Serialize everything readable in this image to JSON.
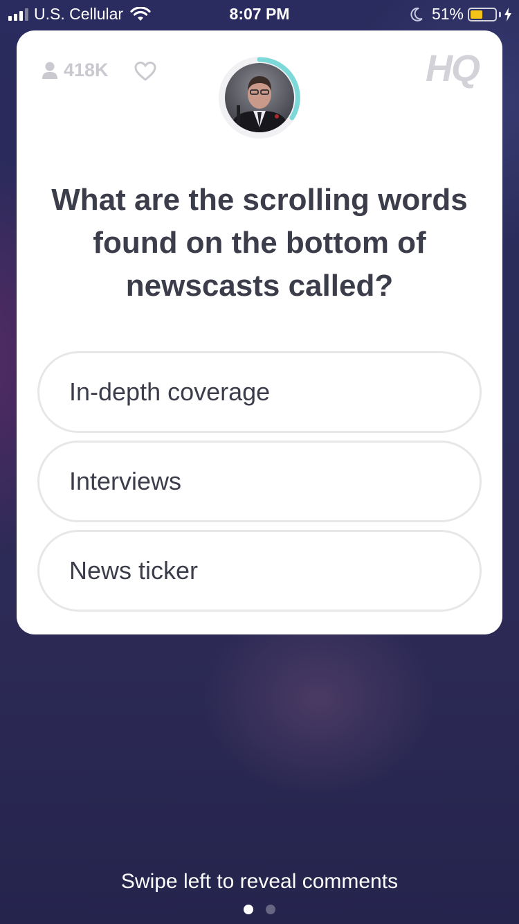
{
  "status_bar": {
    "carrier": "U.S. Cellular",
    "time": "8:07 PM",
    "battery_percent": "51%",
    "battery_level": 0.51,
    "icons": [
      "signal-icon",
      "wifi-icon",
      "moon-icon",
      "battery-icon",
      "charging-bolt-icon"
    ]
  },
  "card": {
    "viewer_count": "418K",
    "logo_text": "HQ",
    "icons": [
      "person-icon",
      "heart-icon"
    ],
    "host_avatar": {
      "timer_ring_color": "#7dd8d8"
    }
  },
  "question": {
    "text": "What are the scrolling words found on the bottom of newscasts called?"
  },
  "answers": [
    {
      "label": "In-depth coverage"
    },
    {
      "label": "Interviews"
    },
    {
      "label": "News ticker"
    }
  ],
  "footer": {
    "swipe_hint": "Swipe left to reveal comments",
    "page_count": 2,
    "active_page": 1
  },
  "colors": {
    "card_background": "#ffffff",
    "question_text": "#3c3d4b",
    "answer_border": "#e7e7ea",
    "muted_gray": "#c9c9cf",
    "battery_fill": "#f2c419"
  }
}
